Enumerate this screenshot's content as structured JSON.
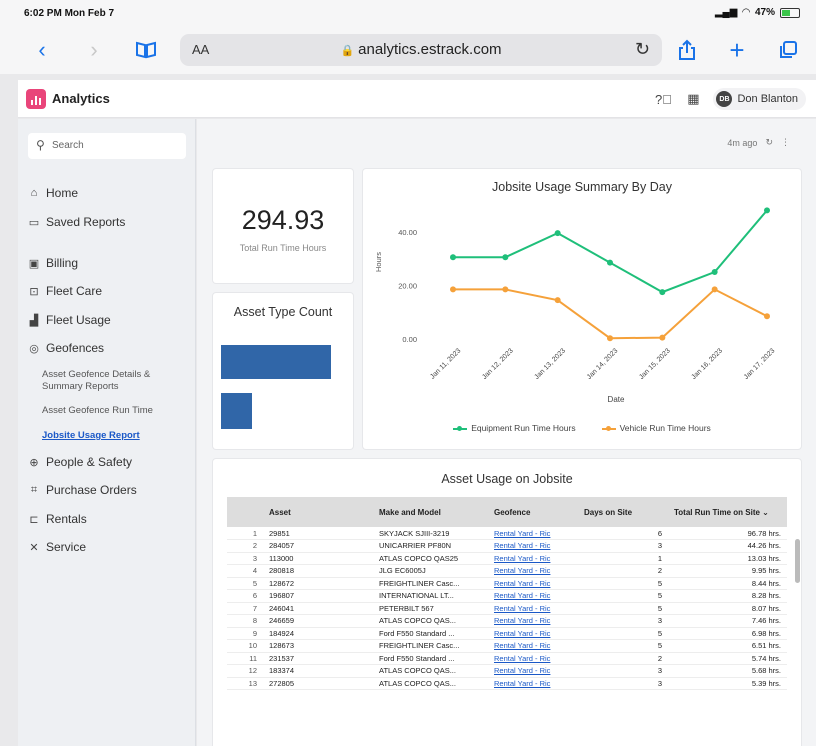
{
  "status": {
    "time": "6:02 PM  Mon Feb 7",
    "battery": "47%"
  },
  "browser": {
    "text_size": "AA",
    "url": "analytics.estrack.com"
  },
  "app": {
    "title": "Analytics",
    "user": {
      "initials": "DB",
      "name": "Don Blanton"
    }
  },
  "sidebar": {
    "search_placeholder": "Search",
    "items": [
      {
        "label": "Home",
        "icon": "home-icon"
      },
      {
        "label": "Saved Reports",
        "icon": "reports-icon"
      },
      {
        "label": "Billing",
        "icon": "billing-icon"
      },
      {
        "label": "Fleet Care",
        "icon": "fleet-care-icon"
      },
      {
        "label": "Fleet Usage",
        "icon": "fleet-usage-icon"
      },
      {
        "label": "Geofences",
        "icon": "geofence-icon"
      },
      {
        "label": "People & Safety",
        "icon": "people-icon"
      },
      {
        "label": "Purchase Orders",
        "icon": "purchase-icon"
      },
      {
        "label": "Rentals",
        "icon": "rentals-icon"
      },
      {
        "label": "Service",
        "icon": "service-icon"
      }
    ],
    "subitems": [
      {
        "label": "Asset Geofence Details & Summary Reports"
      },
      {
        "label": "Asset Geofence Run Time"
      },
      {
        "label": "Jobsite Usage Report"
      }
    ]
  },
  "main": {
    "updated": "4m ago",
    "kpi": {
      "value": "294.93",
      "label": "Total Run Time Hours"
    },
    "asset_type_title": "Asset Type Count",
    "asset_type_bars": [
      0.92,
      0.26
    ],
    "table": {
      "title": "Asset Usage on Jobsite",
      "columns": [
        "Asset",
        "Make and Model",
        "Geofence",
        "Days on Site",
        "Total Run Time on Site"
      ],
      "rows": [
        [
          "1",
          "29851",
          "SKYJACK SJIII-3219",
          "Rental Yard - Ric",
          "6",
          "96.78 hrs."
        ],
        [
          "2",
          "284057",
          "UNICARRIER PF80N",
          "Rental Yard - Ric",
          "3",
          "44.26 hrs."
        ],
        [
          "3",
          "113000",
          "ATLAS COPCO QAS25",
          "Rental Yard - Ric",
          "1",
          "13.03 hrs."
        ],
        [
          "4",
          "280818",
          "JLG EC6005J",
          "Rental Yard - Ric",
          "2",
          "9.95 hrs."
        ],
        [
          "5",
          "128672",
          "FREIGHTLINER Casc...",
          "Rental Yard - Ric",
          "5",
          "8.44 hrs."
        ],
        [
          "6",
          "196807",
          "INTERNATIONAL LT...",
          "Rental Yard - Ric",
          "5",
          "8.28 hrs."
        ],
        [
          "7",
          "246041",
          "PETERBILT 567",
          "Rental Yard - Ric",
          "5",
          "8.07 hrs."
        ],
        [
          "8",
          "246659",
          "ATLAS COPCO QAS...",
          "Rental Yard - Ric",
          "3",
          "7.46 hrs."
        ],
        [
          "9",
          "184924",
          "Ford F550 Standard ...",
          "Rental Yard - Ric",
          "5",
          "6.98 hrs."
        ],
        [
          "10",
          "128673",
          "FREIGHTLINER Casc...",
          "Rental Yard - Ric",
          "5",
          "6.51 hrs."
        ],
        [
          "11",
          "231537",
          "Ford F550 Standard ...",
          "Rental Yard - Ric",
          "2",
          "5.74 hrs."
        ],
        [
          "12",
          "183374",
          "ATLAS COPCO QAS...",
          "Rental Yard - Ric",
          "3",
          "5.68 hrs."
        ],
        [
          "13",
          "272805",
          "ATLAS COPCO QAS...",
          "Rental Yard - Ric",
          "3",
          "5.39 hrs."
        ]
      ]
    }
  },
  "chart_data": {
    "type": "line",
    "title": "Jobsite Usage Summary By Day",
    "xlabel": "Date",
    "ylabel": "Hours",
    "categories": [
      "Jan 11, 2023",
      "Jan 12, 2023",
      "Jan 13, 2023",
      "Jan 14, 2023",
      "Jan 15, 2023",
      "Jan 16, 2023",
      "Jan 17, 2023"
    ],
    "ylim": [
      0,
      50
    ],
    "yticks": [
      0,
      20,
      40
    ],
    "ytick_labels": [
      "0.00",
      "20.00",
      "40.00"
    ],
    "series": [
      {
        "name": "Equipment Run Time Hours",
        "color": "#1fbf7a",
        "values": [
          30.5,
          30.5,
          39.5,
          28.5,
          17.5,
          25,
          48
        ]
      },
      {
        "name": "Vehicle Run Time Hours",
        "color": "#f5a13a",
        "values": [
          18.5,
          18.5,
          14.5,
          0.3,
          0.5,
          18.5,
          8.5
        ]
      }
    ],
    "legend": "bottom",
    "grid": false
  }
}
